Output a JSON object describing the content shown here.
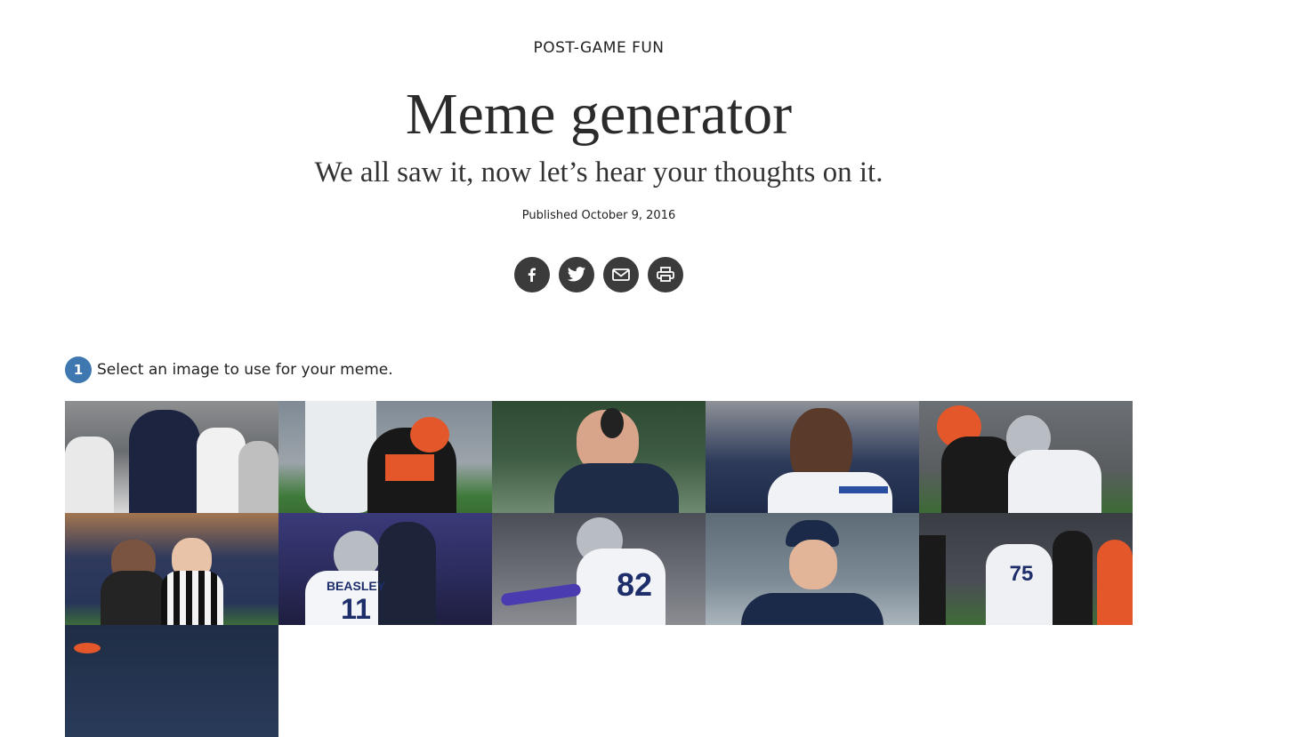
{
  "header": {
    "kicker": "POST-GAME FUN",
    "title": "Meme generator",
    "subtitle": "We all saw it, now let’s hear your thoughts on it.",
    "published": "Published October 9, 2016"
  },
  "share": {
    "buttons": [
      {
        "icon": "facebook-icon"
      },
      {
        "icon": "twitter-icon"
      },
      {
        "icon": "email-icon"
      },
      {
        "icon": "print-icon"
      }
    ]
  },
  "step": {
    "number": "1",
    "text": "Select an image to use for your meme."
  },
  "images": [
    {
      "name": "image-sideline-coaches"
    },
    {
      "name": "image-bengals-qb-14"
    },
    {
      "name": "image-coach-headset"
    },
    {
      "name": "image-smiling-player"
    },
    {
      "name": "image-tackle-bengals-cowboys"
    },
    {
      "name": "image-coach-referee"
    },
    {
      "name": "image-beasley-11",
      "jersey_text": "BEASLEY",
      "jersey_number": "11"
    },
    {
      "name": "image-player-82",
      "jersey_number": "82"
    },
    {
      "name": "image-smiling-qb-cap"
    },
    {
      "name": "image-lineman-75",
      "jersey_number": "75"
    },
    {
      "name": "image-partial"
    }
  ],
  "colors": {
    "share_bg": "#3b3b3b",
    "step_badge": "#3f78b0"
  }
}
